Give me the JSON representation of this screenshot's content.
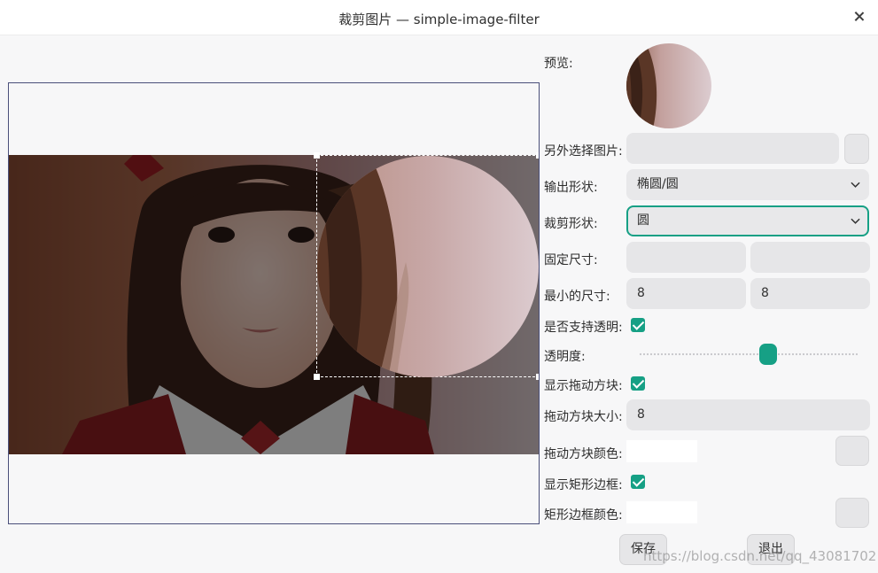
{
  "window": {
    "title": "裁剪图片 — simple-image-filter"
  },
  "labels": {
    "preview": "预览:",
    "select_image": "另外选择图片:",
    "output_shape": "输出形状:",
    "crop_shape": "裁剪形状:",
    "fixed_size": "固定尺寸:",
    "min_size": "最小的尺寸:",
    "support_transparency": "是否支持透明:",
    "opacity": "透明度:",
    "show_handles": "显示拖动方块:",
    "handle_size": "拖动方块大小:",
    "handle_color": "拖动方块颜色:",
    "show_rect_border": "显示矩形边框:",
    "rect_border_color": "矩形边框颜色:"
  },
  "fields": {
    "image_path": "",
    "output_shape_value": "椭圆/圆",
    "crop_shape_value": "圆",
    "fixed_width": "",
    "fixed_height": "",
    "min_width": "8",
    "min_height": "8",
    "handle_size": "8"
  },
  "toggles": {
    "support_transparency": true,
    "show_handles": true,
    "show_rect_border": true
  },
  "opacity_level": 0.6,
  "colors": {
    "accent": "#16a085",
    "handle_color": "#ffffff",
    "rect_border_color": "#ffffff"
  },
  "buttons": {
    "save": "保存",
    "quit": "退出"
  },
  "watermark": "https://blog.csdn.net/qq_43081702"
}
